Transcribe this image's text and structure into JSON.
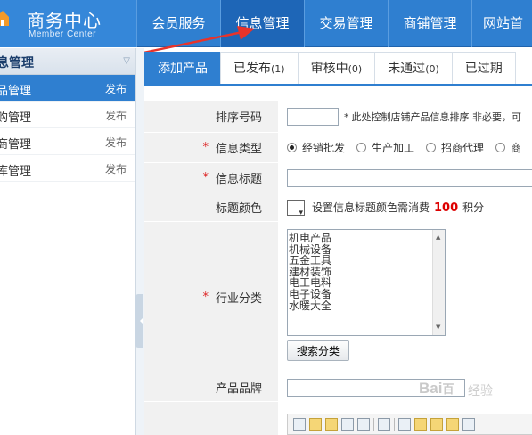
{
  "brand": {
    "title": "商务中心",
    "subtitle": "Member Center"
  },
  "nav": [
    "会员服务",
    "信息管理",
    "交易管理",
    "商铺管理",
    "网站首"
  ],
  "sidebar": {
    "header": "息管理",
    "items": [
      {
        "label": "品管理",
        "action": "发布"
      },
      {
        "label": "购管理",
        "action": "发布"
      },
      {
        "label": "商管理",
        "action": "发布"
      },
      {
        "label": "库管理",
        "action": "发布"
      }
    ]
  },
  "tabs": [
    {
      "label": "添加产品",
      "count": ""
    },
    {
      "label": "已发布",
      "count": "(1)"
    },
    {
      "label": "审核中",
      "count": "(0)"
    },
    {
      "label": "未通过",
      "count": "(0)"
    },
    {
      "label": "已过期",
      "count": ""
    }
  ],
  "form": {
    "sort": {
      "label": "排序号码",
      "value": "",
      "hint_star": "*",
      "hint": "此处控制店铺产品信息排序 非必要，可"
    },
    "info_type": {
      "required": "*",
      "label": "信息类型",
      "options": [
        "经销批发",
        "生产加工",
        "招商代理",
        "商"
      ],
      "selected": 0
    },
    "title": {
      "required": "*",
      "label": "信息标题",
      "value": ""
    },
    "title_color": {
      "label": "标题颜色",
      "text_before": "设置信息标题颜色需消费",
      "points": "100",
      "text_after": "积分"
    },
    "industry": {
      "required": "*",
      "label": "行业分类",
      "options": [
        "机电产品",
        "机械设备",
        "五金工具",
        "建材装饰",
        "电工电料",
        "电子设备",
        "水暖大全"
      ],
      "search_button": "搜索分类"
    },
    "brand": {
      "label": "产品品牌",
      "value": ""
    }
  },
  "watermark": {
    "logo": "Bai",
    "logo_suffix": "百",
    "text": "经验"
  }
}
